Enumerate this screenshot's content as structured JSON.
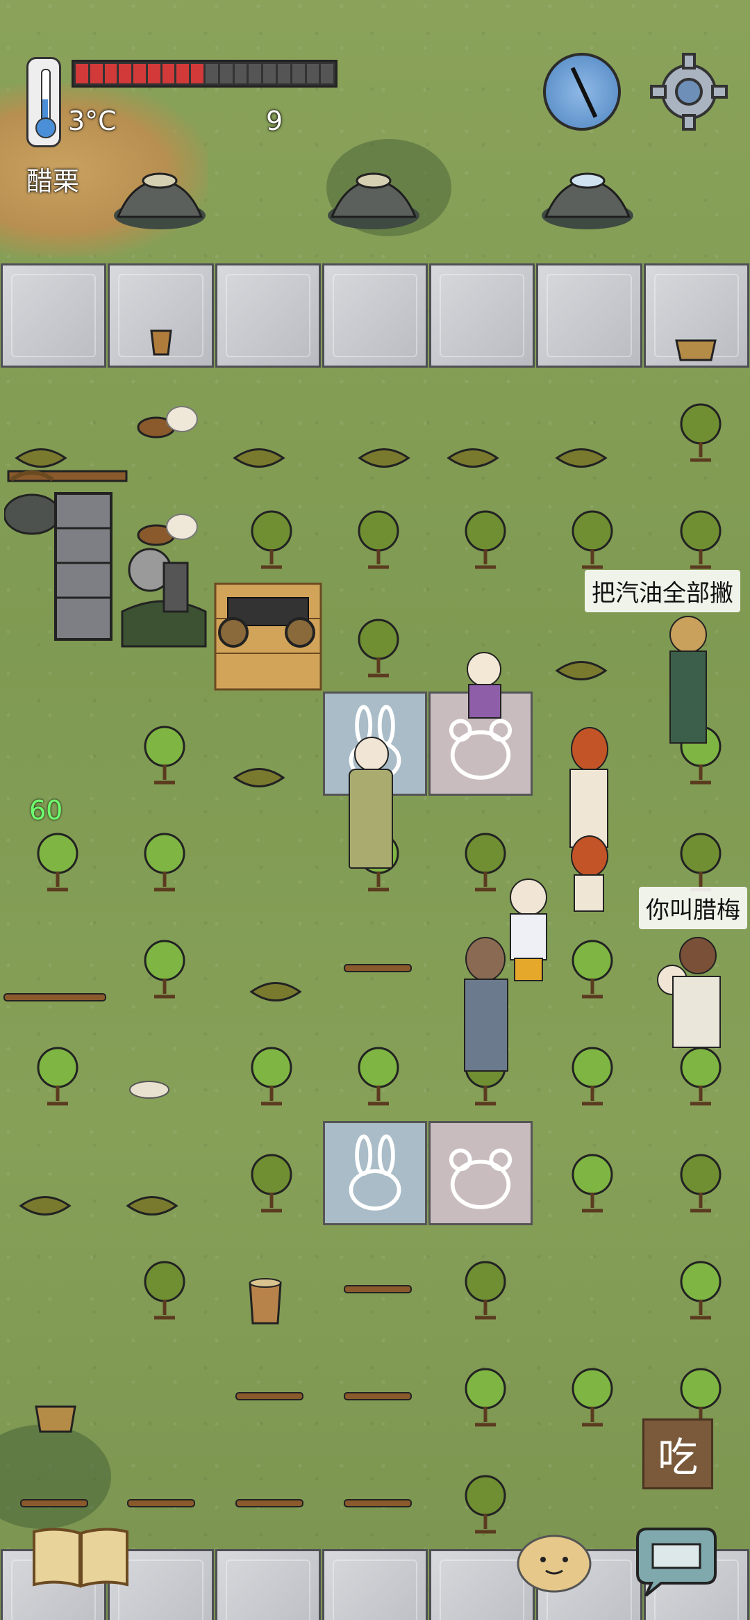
{
  "hud": {
    "temperature": "3°C",
    "food_count": "9",
    "held_item_name": "醋栗",
    "hunger_segments_total": 18,
    "hunger_segments_filled": 9,
    "hunger_color": "#d23a3a"
  },
  "player": {
    "age_label": "60"
  },
  "speech": {
    "line1": "把汽油全部撇",
    "line2": "你叫腊梅"
  },
  "buttons": {
    "eat": "吃",
    "book": "book-icon",
    "emote": "emote-face-icon",
    "keyboard": "keyboard-icon",
    "settings": "gear-icon",
    "compass": "compass-icon"
  }
}
